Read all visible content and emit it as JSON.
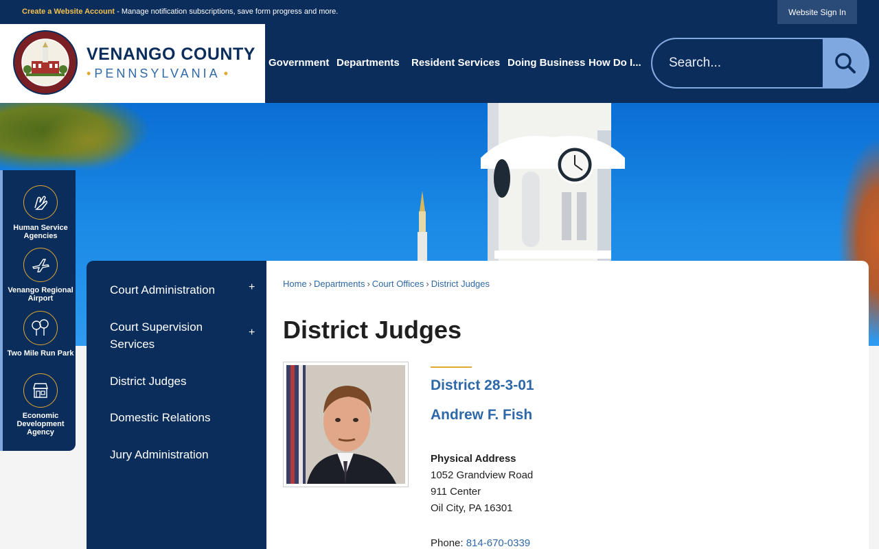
{
  "topbar": {
    "create_account": "Create a Website Account",
    "message": " - Manage notification subscriptions, save form progress and more.",
    "sign_in": "Website Sign In"
  },
  "logo": {
    "county": "VENANGO COUNTY",
    "state": "PENNSYLVANIA",
    "seal_text_top": "COUNTY OF VENANGO",
    "seal_text_bottom": "FRANKLIN · PENNSYLVANIA"
  },
  "nav": {
    "items": [
      {
        "label": "Government"
      },
      {
        "label": "Departments"
      },
      {
        "label": "Resident Services"
      },
      {
        "label": "Doing Business"
      },
      {
        "label": "How Do I..."
      }
    ]
  },
  "search": {
    "placeholder": "Search..."
  },
  "quick_links": [
    {
      "label": "Human Service Agencies",
      "icon": "hands-icon"
    },
    {
      "label": "Venango Regional Airport",
      "icon": "airplane-icon"
    },
    {
      "label": "Two Mile Run Park",
      "icon": "trees-icon"
    },
    {
      "label": "Economic Development Agency",
      "icon": "storefront-icon"
    }
  ],
  "sidenav": {
    "items": [
      {
        "label": "Court Administration",
        "toggle": "+"
      },
      {
        "label": "Court Supervision Services",
        "toggle": "+"
      },
      {
        "label": "District Judges"
      },
      {
        "label": "Domestic Relations"
      },
      {
        "label": "Jury Administration"
      }
    ]
  },
  "breadcrumb": {
    "home": "Home",
    "departments": "Departments",
    "court_offices": "Court Offices",
    "current": "District Judges"
  },
  "page": {
    "title": "District Judges",
    "district": "District 28-3-01",
    "judge": "Andrew F. Fish",
    "address_heading": "Physical Address",
    "address_lines": [
      "1052 Grandview Road",
      "911 Center",
      "Oil City, PA 16301"
    ],
    "phone_label": "Phone: ",
    "phone": "814-670-0339"
  },
  "colors": {
    "navy": "#0b2d5c",
    "gold": "#e0a82e",
    "link_blue": "#2e68a8",
    "light_blue": "#7fa8e0"
  }
}
